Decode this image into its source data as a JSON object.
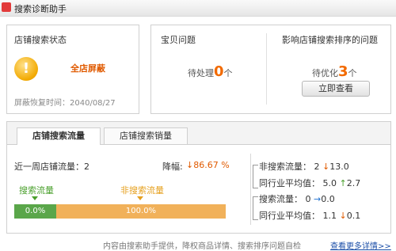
{
  "window": {
    "title": "搜索诊断助手"
  },
  "status": {
    "title": "店铺搜索状态",
    "state": "全店屏蔽",
    "restore_label": "屏蔽恢复时间：2040/08/27"
  },
  "issues": {
    "baby_title": "宝贝问题",
    "baby_pending_prefix": "待处理",
    "baby_count": "0",
    "baby_unit": "个",
    "ranking_title": "影响店铺搜索排序的问题",
    "ranking_pending_prefix": "待优化",
    "ranking_count": "3",
    "ranking_unit": "个",
    "view_button": "立即查看"
  },
  "tabs": [
    {
      "label": "店铺搜索流量"
    },
    {
      "label": "店铺搜索销量"
    }
  ],
  "traffic": {
    "weekly_label": "近一周店铺流量：2",
    "drop_label": "降幅:",
    "drop_value": "86.67 %",
    "search_traffic_label": "搜索流量",
    "non_search_traffic_label": "非搜索流量",
    "search_pct": "0.0%",
    "non_search_pct": "100.0%",
    "search_share": 0.0,
    "non_search_share": 100.0
  },
  "comparison": {
    "non_search_label": "非搜索流量：",
    "non_search_value": "2",
    "non_search_change": "13.0",
    "industry_avg_label_1": "同行业平均值：",
    "industry_avg_value_1": "5.0",
    "industry_avg_change_1": "2.7",
    "search_label": "搜索流量：",
    "search_value": "0",
    "search_change": "0.0",
    "industry_avg_label_2": "同行业平均值：",
    "industry_avg_value_2": "1.1",
    "industry_avg_change_2": "0.1"
  },
  "footer": {
    "note": "内容由搜索助手提供，降权商品详情、搜索排序问题自检",
    "more_link": "查看更多详情>>"
  },
  "colors": {
    "accent_orange": "#f26a00",
    "bar_green": "#5aa64a",
    "bar_orange": "#f1b15a",
    "link_blue": "#1c4fa8"
  },
  "icons": [
    "warning-icon",
    "down-arrow-icon",
    "up-arrow-icon"
  ]
}
